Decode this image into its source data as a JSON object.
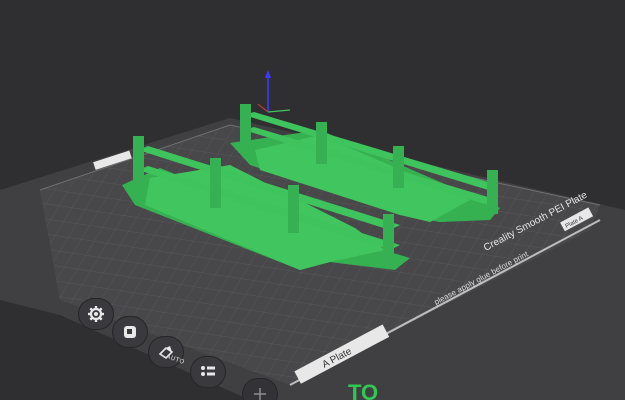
{
  "plate": {
    "name_label": "A Plate",
    "badge": "A Plate",
    "build_plate_name": "Creality Smooth PEI Plate",
    "note": "please apply glue before print",
    "corner_label": "Plate A",
    "bottom_logo": "TO"
  },
  "toolbar": {
    "settings": {
      "icon": "gear-icon"
    },
    "camera": {
      "icon": "camera-icon"
    },
    "auto_arrange": {
      "icon": "auto-arrange-icon",
      "label": "AUTO"
    },
    "objects": {
      "icon": "objects-icon"
    },
    "add_plate": {
      "icon": "plus-icon"
    }
  },
  "colors": {
    "background": "#2f2f32",
    "plate_surface": "#4a4a4d",
    "grid": "#5a5a5e",
    "model": "#3fc35c",
    "axis_z": "#3b3bff",
    "accent": "#30c850"
  }
}
